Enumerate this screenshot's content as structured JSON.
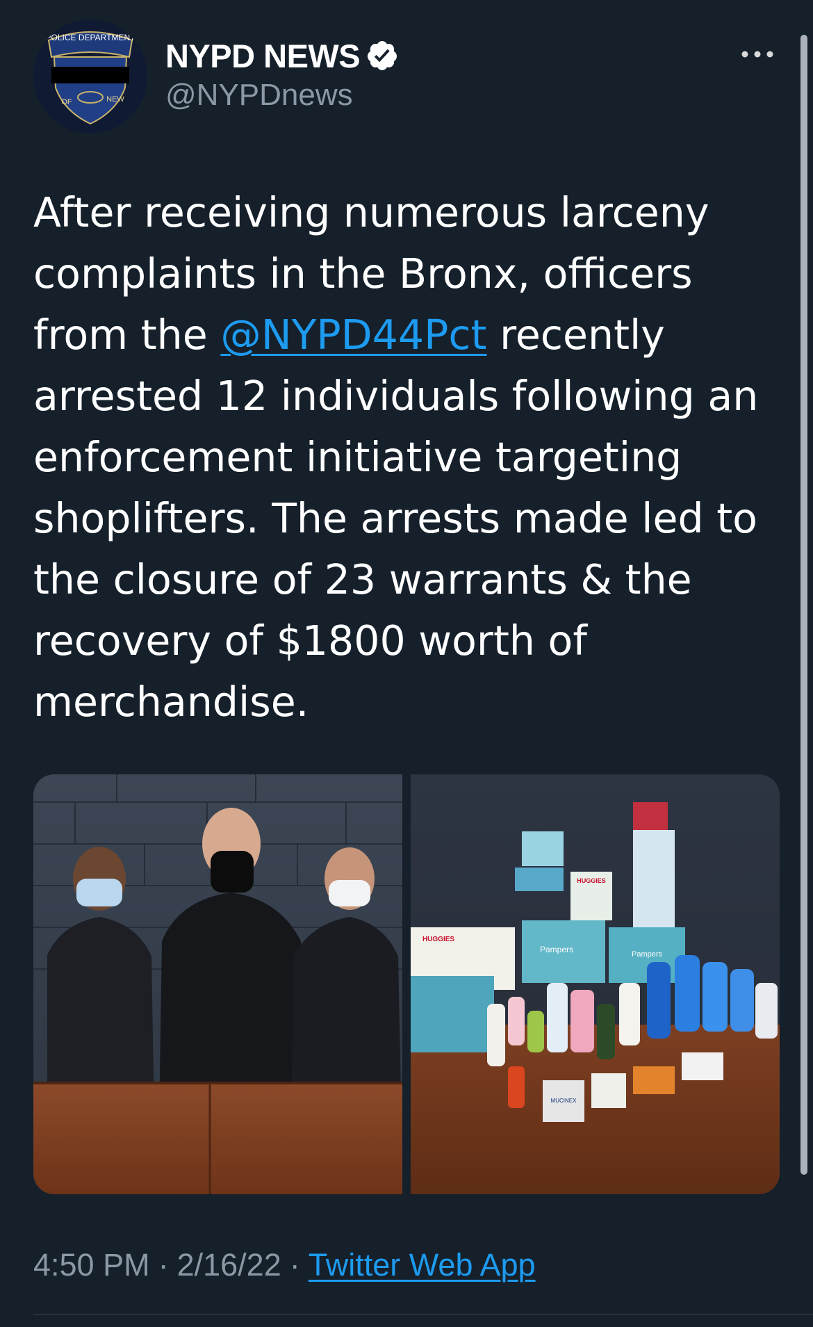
{
  "tweet": {
    "author": {
      "display_name": "NYPD NEWS",
      "handle": "@NYPDnews",
      "verified": true,
      "avatar_text_top": "POLICE DEPARTMENT",
      "avatar_text_bottom_left": "OF",
      "avatar_text_bottom_right": "NEW"
    },
    "more_icon": "more-horizontal-icon",
    "text": {
      "before_mention": "After receiving numerous larceny complaints in the Bronx, officers from the ",
      "mention": "@NYPD44Pct",
      "after_mention": " recently arrested 12 individuals following an enforcement initiative targeting shoplifters. The arrests made led to the closure of 23 warrants & the recovery of $1800 worth of merchandise."
    },
    "media": {
      "photos": [
        {
          "label_1": "",
          "label_2": ""
        },
        {
          "label_huggies": "HUGGIES",
          "label_pampers": "Pampers",
          "label_mucinex": "MUCINEX"
        }
      ]
    },
    "time": "4:50 PM",
    "separator": "·",
    "date": "2/16/22",
    "source": "Twitter Web App"
  },
  "colors": {
    "background": "#15202b",
    "text_primary": "#ffffff",
    "text_secondary": "#8b98a5",
    "link": "#1d9bf0",
    "verified_badge": "#ffffff"
  }
}
